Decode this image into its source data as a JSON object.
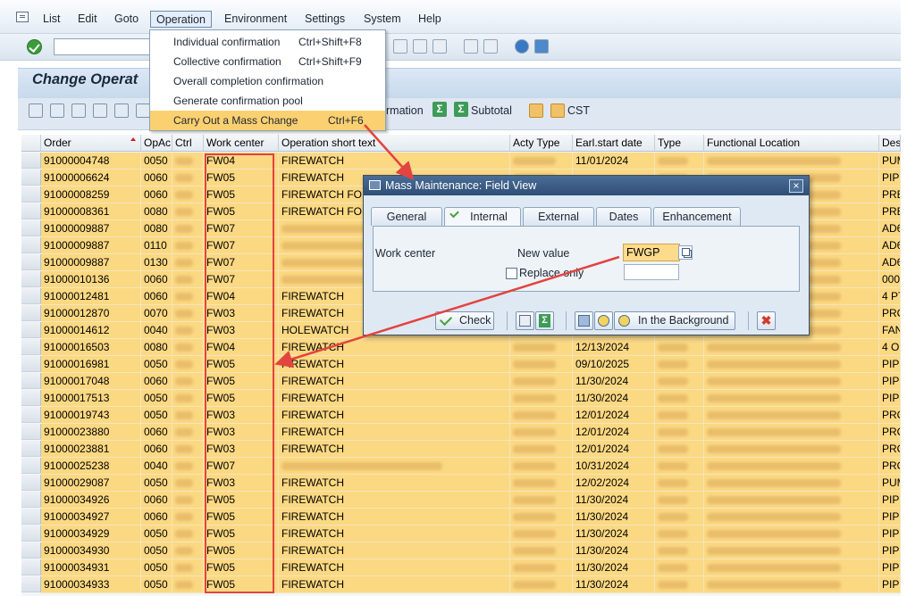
{
  "menu": {
    "items": [
      "List",
      "Edit",
      "Goto",
      "Operation",
      "Environment",
      "Settings",
      "System",
      "Help"
    ],
    "active": "Operation"
  },
  "page_title": "Change Operat",
  "app_toolbar": {
    "partial_label": "rmation",
    "subtotal": "Subtotal",
    "cst": "CST"
  },
  "operation_menu": [
    {
      "label": "Individual confirmation",
      "shortcut": "Ctrl+Shift+F8"
    },
    {
      "label": "Collective confirmation",
      "shortcut": "Ctrl+Shift+F9"
    },
    {
      "label": "Overall completion confirmation",
      "shortcut": ""
    },
    {
      "label": "Generate confirmation pool",
      "shortcut": ""
    },
    {
      "label": "Carry Out a Mass Change",
      "shortcut": "Ctrl+F6"
    }
  ],
  "grid": {
    "columns": [
      "Order",
      "OpAc",
      "Ctrl",
      "Work center",
      "Operation short text",
      "Acty Type",
      "Earl.start date",
      "Type",
      "Functional Location",
      "Des"
    ],
    "rows": [
      {
        "order": "91000004748",
        "opac": "0050",
        "wc": "FW04",
        "text": "FIREWATCH",
        "date": "11/01/2024",
        "des": "PUM"
      },
      {
        "order": "91000006624",
        "opac": "0060",
        "wc": "FW05",
        "text": "FIREWATCH",
        "date": "",
        "des": "PIPI"
      },
      {
        "order": "91000008259",
        "opac": "0060",
        "wc": "FW05",
        "text": "FIREWATCH FOR",
        "date": "",
        "des": "PRE"
      },
      {
        "order": "91000008361",
        "opac": "0080",
        "wc": "FW05",
        "text": "FIREWATCH FOR",
        "date": "",
        "des": "PRE"
      },
      {
        "order": "91000009887",
        "opac": "0080",
        "wc": "FW07",
        "text": "",
        "date": "",
        "des": "AD6"
      },
      {
        "order": "91000009887",
        "opac": "0110",
        "wc": "FW07",
        "text": "",
        "date": "",
        "des": "AD6"
      },
      {
        "order": "91000009887",
        "opac": "0130",
        "wc": "FW07",
        "text": "",
        "date": "",
        "des": "AD6"
      },
      {
        "order": "91000010136",
        "opac": "0060",
        "wc": "FW07",
        "text": "",
        "date": "",
        "des": "000"
      },
      {
        "order": "91000012481",
        "opac": "0060",
        "wc": "FW04",
        "text": "FIREWATCH",
        "date": "",
        "des": "4 PT"
      },
      {
        "order": "91000012870",
        "opac": "0070",
        "wc": "FW03",
        "text": "FIREWATCH",
        "date": "",
        "des": "PRO"
      },
      {
        "order": "91000014612",
        "opac": "0040",
        "wc": "FW03",
        "text": "HOLEWATCH",
        "date": "",
        "des": "FAN"
      },
      {
        "order": "91000016503",
        "opac": "0080",
        "wc": "FW04",
        "text": "FIREWATCH",
        "date": "12/13/2024",
        "des": "4 O"
      },
      {
        "order": "91000016981",
        "opac": "0050",
        "wc": "FW05",
        "text": "FIREWATCH",
        "date": "09/10/2025",
        "des": "PIPI"
      },
      {
        "order": "91000017048",
        "opac": "0060",
        "wc": "FW05",
        "text": "FIREWATCH",
        "date": "11/30/2024",
        "des": "PIPI"
      },
      {
        "order": "91000017513",
        "opac": "0050",
        "wc": "FW05",
        "text": "FIREWATCH",
        "date": "11/30/2024",
        "des": "PIPI"
      },
      {
        "order": "91000019743",
        "opac": "0050",
        "wc": "FW03",
        "text": "FIREWATCH",
        "date": "12/01/2024",
        "des": "PRO"
      },
      {
        "order": "91000023880",
        "opac": "0060",
        "wc": "FW03",
        "text": "FIREWATCH",
        "date": "12/01/2024",
        "des": "PRO"
      },
      {
        "order": "91000023881",
        "opac": "0060",
        "wc": "FW03",
        "text": "FIREWATCH",
        "date": "12/01/2024",
        "des": "PRO"
      },
      {
        "order": "91000025238",
        "opac": "0040",
        "wc": "FW07",
        "text": "",
        "date": "10/31/2024",
        "des": "PRO"
      },
      {
        "order": "91000029087",
        "opac": "0050",
        "wc": "FW03",
        "text": "FIREWATCH",
        "date": "12/02/2024",
        "des": "PUM"
      },
      {
        "order": "91000034926",
        "opac": "0060",
        "wc": "FW05",
        "text": "FIREWATCH",
        "date": "11/30/2024",
        "des": "PIPI"
      },
      {
        "order": "91000034927",
        "opac": "0060",
        "wc": "FW05",
        "text": "FIREWATCH",
        "date": "11/30/2024",
        "des": "PIPI"
      },
      {
        "order": "91000034929",
        "opac": "0050",
        "wc": "FW05",
        "text": "FIREWATCH",
        "date": "11/30/2024",
        "des": "PIPI"
      },
      {
        "order": "91000034930",
        "opac": "0050",
        "wc": "FW05",
        "text": "FIREWATCH",
        "date": "11/30/2024",
        "des": "PIPI"
      },
      {
        "order": "91000034931",
        "opac": "0050",
        "wc": "FW05",
        "text": "FIREWATCH",
        "date": "11/30/2024",
        "des": "PIPI"
      },
      {
        "order": "91000034933",
        "opac": "0050",
        "wc": "FW05",
        "text": "FIREWATCH",
        "date": "11/30/2024",
        "des": "PIPI"
      }
    ]
  },
  "dialog": {
    "title": "Mass Maintenance: Field View",
    "tabs": [
      "General",
      "Internal",
      "External",
      "Dates",
      "Enhancement"
    ],
    "active_tab": "Internal",
    "field_label": "Work center",
    "new_value_label": "New value",
    "new_value": "FWGP",
    "replace_only_label": "Replace only",
    "buttons": {
      "check": "Check",
      "background": "In the Background"
    }
  },
  "colors": {
    "highlight": "#fbd882",
    "annotation": "#e2443f",
    "dialog_title": "#2e4e76"
  }
}
